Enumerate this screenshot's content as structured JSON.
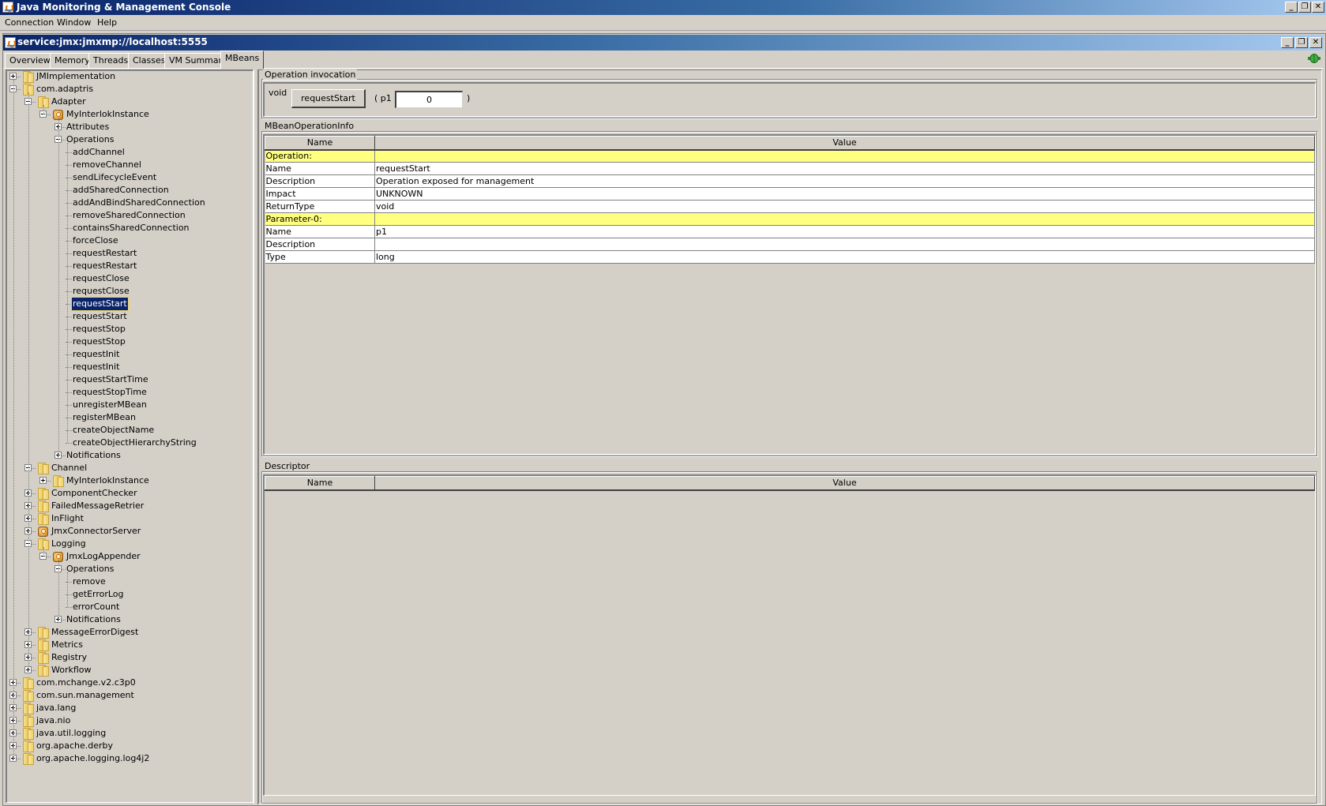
{
  "app": {
    "title": "Java Monitoring & Management Console",
    "window_controls": {
      "minimize": "_",
      "restore": "❐",
      "close": "✕"
    }
  },
  "menu": [
    "Connection",
    "Window",
    "Help"
  ],
  "connection_window": {
    "title": "service:jmx:jmxmp://localhost:5555",
    "status_icon": "connected-plug-icon"
  },
  "tabs": [
    {
      "label": "Overview",
      "active": false
    },
    {
      "label": "Memory",
      "active": false
    },
    {
      "label": "Threads",
      "active": false
    },
    {
      "label": "Classes",
      "active": false
    },
    {
      "label": "VM Summary",
      "active": false
    },
    {
      "label": "MBeans",
      "active": true
    }
  ],
  "tree": [
    {
      "label": "JMImplementation",
      "level": 0,
      "icon": "folder",
      "expander": "plus"
    },
    {
      "label": "com.adaptris",
      "level": 0,
      "icon": "folder",
      "expander": "minus"
    },
    {
      "label": "Adapter",
      "level": 1,
      "icon": "folder",
      "expander": "minus"
    },
    {
      "label": "MyInterlokInstance",
      "level": 2,
      "icon": "mbean",
      "expander": "minus"
    },
    {
      "label": "Attributes",
      "level": 3,
      "icon": "none",
      "expander": "plus"
    },
    {
      "label": "Operations",
      "level": 3,
      "icon": "none",
      "expander": "minus"
    },
    {
      "label": "addChannel",
      "level": 4,
      "icon": "none",
      "expander": "none"
    },
    {
      "label": "removeChannel",
      "level": 4,
      "icon": "none",
      "expander": "none"
    },
    {
      "label": "sendLifecycleEvent",
      "level": 4,
      "icon": "none",
      "expander": "none"
    },
    {
      "label": "addSharedConnection",
      "level": 4,
      "icon": "none",
      "expander": "none"
    },
    {
      "label": "addAndBindSharedConnection",
      "level": 4,
      "icon": "none",
      "expander": "none"
    },
    {
      "label": "removeSharedConnection",
      "level": 4,
      "icon": "none",
      "expander": "none"
    },
    {
      "label": "containsSharedConnection",
      "level": 4,
      "icon": "none",
      "expander": "none"
    },
    {
      "label": "forceClose",
      "level": 4,
      "icon": "none",
      "expander": "none"
    },
    {
      "label": "requestRestart",
      "level": 4,
      "icon": "none",
      "expander": "none"
    },
    {
      "label": "requestRestart",
      "level": 4,
      "icon": "none",
      "expander": "none"
    },
    {
      "label": "requestClose",
      "level": 4,
      "icon": "none",
      "expander": "none"
    },
    {
      "label": "requestClose",
      "level": 4,
      "icon": "none",
      "expander": "none"
    },
    {
      "label": "requestStart",
      "level": 4,
      "icon": "none",
      "expander": "none",
      "selected": true
    },
    {
      "label": "requestStart",
      "level": 4,
      "icon": "none",
      "expander": "none"
    },
    {
      "label": "requestStop",
      "level": 4,
      "icon": "none",
      "expander": "none"
    },
    {
      "label": "requestStop",
      "level": 4,
      "icon": "none",
      "expander": "none"
    },
    {
      "label": "requestInit",
      "level": 4,
      "icon": "none",
      "expander": "none"
    },
    {
      "label": "requestInit",
      "level": 4,
      "icon": "none",
      "expander": "none"
    },
    {
      "label": "requestStartTime",
      "level": 4,
      "icon": "none",
      "expander": "none"
    },
    {
      "label": "requestStopTime",
      "level": 4,
      "icon": "none",
      "expander": "none"
    },
    {
      "label": "unregisterMBean",
      "level": 4,
      "icon": "none",
      "expander": "none"
    },
    {
      "label": "registerMBean",
      "level": 4,
      "icon": "none",
      "expander": "none"
    },
    {
      "label": "createObjectName",
      "level": 4,
      "icon": "none",
      "expander": "none"
    },
    {
      "label": "createObjectHierarchyString",
      "level": 4,
      "icon": "none",
      "expander": "none"
    },
    {
      "label": "Notifications",
      "level": 3,
      "icon": "none",
      "expander": "plus"
    },
    {
      "label": "Channel",
      "level": 1,
      "icon": "folder",
      "expander": "minus"
    },
    {
      "label": "MyInterlokInstance",
      "level": 2,
      "icon": "folder",
      "expander": "plus"
    },
    {
      "label": "ComponentChecker",
      "level": 1,
      "icon": "folder",
      "expander": "plus"
    },
    {
      "label": "FailedMessageRetrier",
      "level": 1,
      "icon": "folder",
      "expander": "plus"
    },
    {
      "label": "InFlight",
      "level": 1,
      "icon": "folder",
      "expander": "plus"
    },
    {
      "label": "JmxConnectorServer",
      "level": 1,
      "icon": "mbean",
      "expander": "plus"
    },
    {
      "label": "Logging",
      "level": 1,
      "icon": "folder",
      "expander": "minus"
    },
    {
      "label": "JmxLogAppender",
      "level": 2,
      "icon": "mbean",
      "expander": "minus"
    },
    {
      "label": "Operations",
      "level": 3,
      "icon": "none",
      "expander": "minus"
    },
    {
      "label": "remove",
      "level": 4,
      "icon": "none",
      "expander": "none"
    },
    {
      "label": "getErrorLog",
      "level": 4,
      "icon": "none",
      "expander": "none"
    },
    {
      "label": "errorCount",
      "level": 4,
      "icon": "none",
      "expander": "none"
    },
    {
      "label": "Notifications",
      "level": 3,
      "icon": "none",
      "expander": "plus"
    },
    {
      "label": "MessageErrorDigest",
      "level": 1,
      "icon": "folder",
      "expander": "plus"
    },
    {
      "label": "Metrics",
      "level": 1,
      "icon": "folder",
      "expander": "plus"
    },
    {
      "label": "Registry",
      "level": 1,
      "icon": "folder",
      "expander": "plus"
    },
    {
      "label": "Workflow",
      "level": 1,
      "icon": "folder",
      "expander": "plus"
    },
    {
      "label": "com.mchange.v2.c3p0",
      "level": 0,
      "icon": "folder",
      "expander": "plus"
    },
    {
      "label": "com.sun.management",
      "level": 0,
      "icon": "folder",
      "expander": "plus"
    },
    {
      "label": "java.lang",
      "level": 0,
      "icon": "folder",
      "expander": "plus"
    },
    {
      "label": "java.nio",
      "level": 0,
      "icon": "folder",
      "expander": "plus"
    },
    {
      "label": "java.util.logging",
      "level": 0,
      "icon": "folder",
      "expander": "plus"
    },
    {
      "label": "org.apache.derby",
      "level": 0,
      "icon": "folder",
      "expander": "plus"
    },
    {
      "label": "org.apache.logging.log4j2",
      "level": 0,
      "icon": "folder",
      "expander": "plus"
    }
  ],
  "invocation": {
    "legend": "Operation invocation",
    "return_type": "void",
    "button_label": "requestStart",
    "open_paren": "( p1",
    "param_value": "0",
    "close_paren": ")"
  },
  "operation_info": {
    "legend": "MBeanOperationInfo",
    "columns": [
      "Name",
      "Value"
    ],
    "rows": [
      {
        "name": "Operation:",
        "value": "",
        "section": true
      },
      {
        "name": "Name",
        "value": "requestStart"
      },
      {
        "name": "Description",
        "value": "Operation exposed for management"
      },
      {
        "name": "Impact",
        "value": "UNKNOWN"
      },
      {
        "name": "ReturnType",
        "value": "void"
      },
      {
        "name": "Parameter-0:",
        "value": "",
        "section": true
      },
      {
        "name": "Name",
        "value": "p1"
      },
      {
        "name": "Description",
        "value": ""
      },
      {
        "name": "Type",
        "value": "long"
      }
    ]
  },
  "descriptor": {
    "legend": "Descriptor",
    "columns": [
      "Name",
      "Value"
    ],
    "rows": []
  },
  "colors": {
    "section_row": "#ffff80",
    "selection": "#0a246a",
    "titlebar_start": "#0a246a",
    "titlebar_end": "#a6caf0",
    "window_bg": "#d4d0c8"
  }
}
